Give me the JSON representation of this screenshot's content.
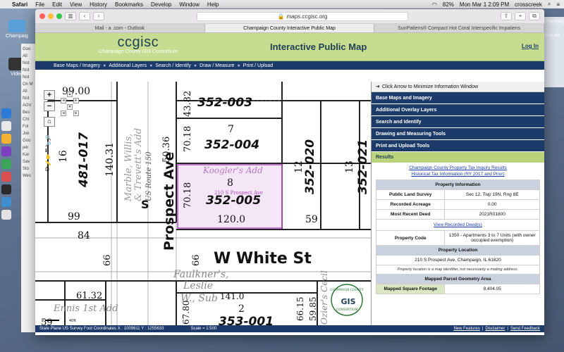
{
  "menubar": {
    "app": "Safari",
    "items": [
      "File",
      "Edit",
      "View",
      "History",
      "Bookmarks",
      "Develop",
      "Window",
      "Help"
    ],
    "battery": "82%",
    "clock": "Mon Mar 1  2:09 PM",
    "user": "crosscreek"
  },
  "desktop": {
    "icons": [
      "Champaig",
      "Video"
    ],
    "bg_window_lines": [
      "Goo",
      "All",
      "Not",
      "Not",
      "Not",
      "On M",
      "All",
      "Not",
      "AGV",
      "Bes",
      "Chi",
      "Fol",
      "Jok",
      "Goo",
      "jetr",
      "Kar",
      "Sav",
      "Sto",
      "Wes"
    ],
    "right_lines": [
      "Champaig",
      "4:14 AM"
    ]
  },
  "browser": {
    "url": "maps.ccgisc.org",
    "tabs": [
      {
        "label": "Mail - a .com - Outlook",
        "active": false
      },
      {
        "label": "Champaign County Interactive Public Map",
        "active": true
      },
      {
        "label": "SunPatiens® Compact Hot Coral Interspecific Impatiens",
        "active": false
      }
    ]
  },
  "site": {
    "logo_text": "ccgisc",
    "logo_sub": "Champaign County GIS Consortium",
    "title": "Interactive Public Map",
    "login": "Log In",
    "nav": [
      "Base Maps / Imagery",
      "Additional Layers",
      "Search / Identify",
      "Draw / Measure",
      "Print / Upload"
    ]
  },
  "map": {
    "labels": {
      "parcel_352_003": "352-003",
      "parcel_352_004": "352-004",
      "parcel_352_005": "352-005",
      "parcel_352_020": "352-020",
      "parcel_352_021": "352-021",
      "parcel_481_017": "481-017",
      "parcel_353_001": "353-001",
      "prospect_ave": "Prospect Ave",
      "white_st": "W White St",
      "us_route": "US Route 150",
      "koogler": "Koogler's Add",
      "faulkner": "Faulkner's,",
      "leslie": "Leslie",
      "w_sub": "W., Sub",
      "ennis": "Ennis 1st Add",
      "ozier": "Ozier's Cecil",
      "marble": "Marble, Willis,",
      "trevett": "& Trevett's Add",
      "address": "210 S Prospect Ave",
      "seal_top": "CHAMPAIGN COUNTY",
      "seal_mid": "GIS",
      "seal_bot": "CONSORTIUM",
      "n_7": "7",
      "n_8": "8",
      "n_12": "12",
      "n_13": "13",
      "n_16": "16",
      "n_2": "2",
      "n_99": "99",
      "n_84": "84",
      "n_66a": "66",
      "n_66b": "66",
      "n_59": "59",
      "n_59b": "59",
      "n_120": "120.0",
      "n_141": "141.0",
      "n_140": "140.31",
      "n_43": "43.82",
      "n_5036": "50.36",
      "n_7018a": "70.18",
      "n_7018b": "70.18",
      "n_6132": "61.32",
      "n_6780": "67.80",
      "n_6615": "66.15",
      "n_5985": "59.85",
      "n_9900": "99.00",
      "n_s": "S",
      "n_4oft": "40ft"
    }
  },
  "status": {
    "coords": "State Plane US Survey Foot Coordinates   X : 1009611   Y : 1255633",
    "scale": "Scale = 1:500",
    "links": [
      "New Features",
      "Disclaimer",
      "Send Feedback"
    ]
  },
  "panel": {
    "minimize_text": "Click Arrow to Minimize Information Window",
    "sections": [
      "Base Maps and Imagery",
      "Additional Overlay Layers",
      "Search and Identify",
      "Drawing and Measuring Tools",
      "Print and Upload Tools"
    ],
    "results_label": "Results",
    "link1": "Champaign County Property Tax Inquiry Results",
    "link2": "Historical Tax Information (RY 2017 and Prior)",
    "property_info_header": "Property Information",
    "plss_label": "Public Land Survey",
    "plss_value": "Sec 12, Twp 19N, Rng 8E",
    "acreage_label": "Recorded Acreage",
    "acreage_value": "0.00",
    "deed_label": "Most Recent Deed",
    "deed_value": "2021R01800",
    "view_deeds": "View Recorded Deed(s)",
    "code_label": "Property Code",
    "code_value": "1350 - Apartments 3 to 7 Units (with owner occupied exemption)",
    "location_header": "Property Location",
    "location_value": "210 S Prospect Ave, Champaign, IL 61820",
    "location_note": "Property location is a map identifier, not necessarily a mailing address.",
    "geometry_header": "Mapped Parcel Geometry Area",
    "sqft_label": "Mapped Square Footage",
    "sqft_value": "8,404.05"
  }
}
